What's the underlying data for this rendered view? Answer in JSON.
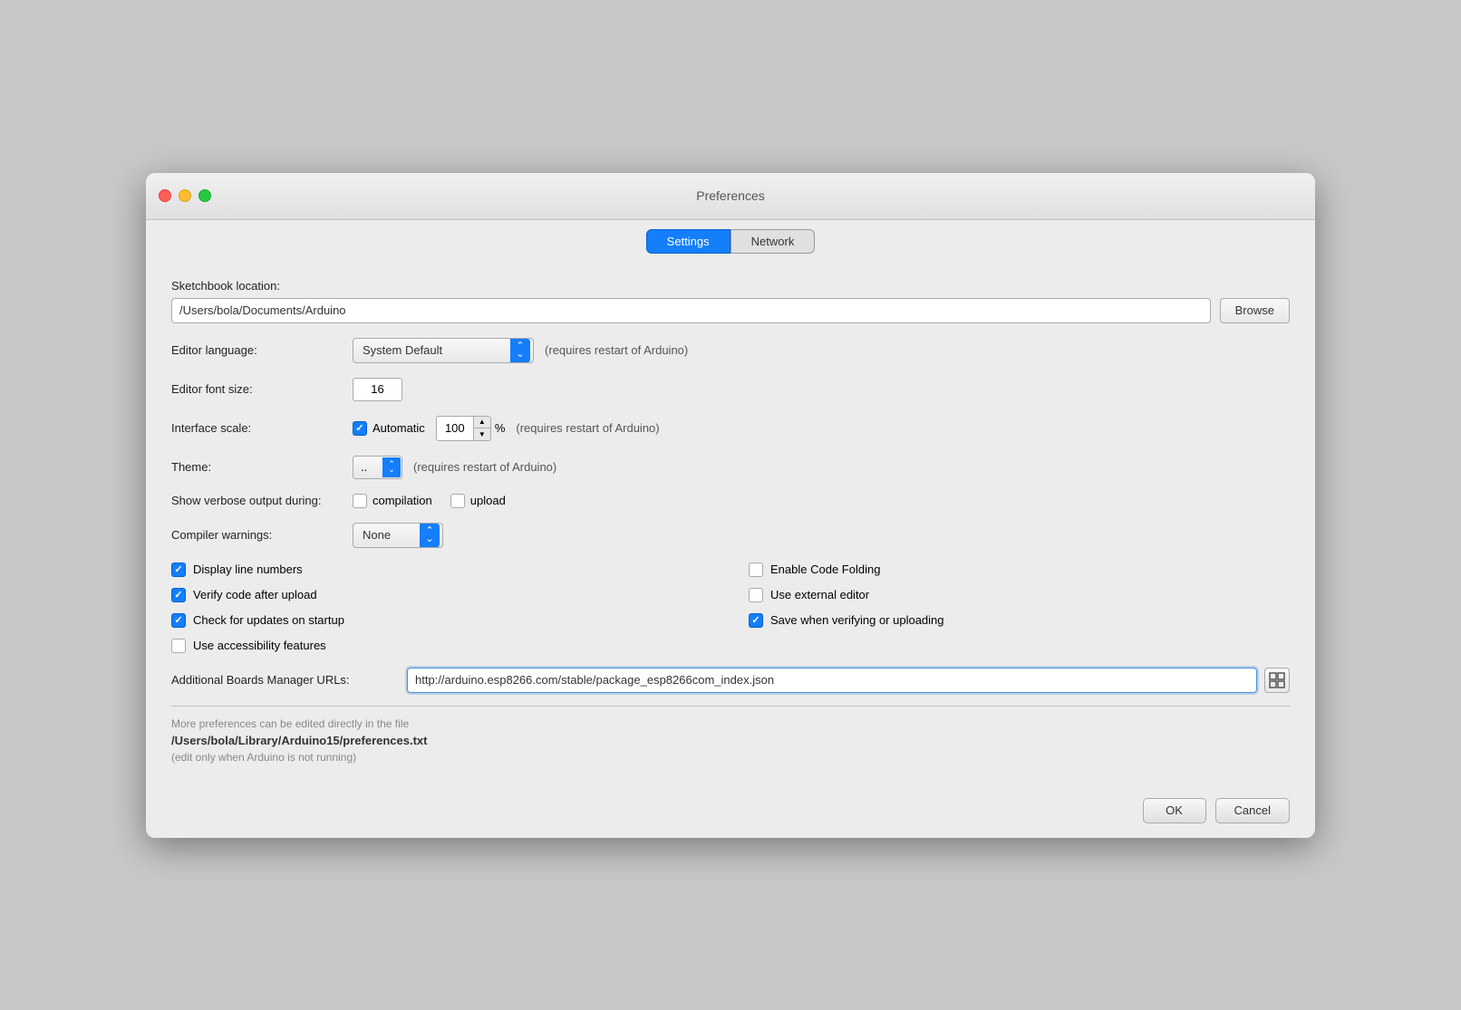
{
  "window": {
    "title": "Preferences"
  },
  "tabs": [
    {
      "id": "settings",
      "label": "Settings",
      "active": true
    },
    {
      "id": "network",
      "label": "Network",
      "active": false
    }
  ],
  "sketchbook": {
    "label": "Sketchbook location:",
    "value": "/Users/bola/Documents/Arduino",
    "browse_label": "Browse"
  },
  "editor_language": {
    "label": "Editor language:",
    "value": "System Default",
    "note": "(requires restart of Arduino)"
  },
  "editor_font_size": {
    "label": "Editor font size:",
    "value": "16"
  },
  "interface_scale": {
    "label": "Interface scale:",
    "auto_label": "Automatic",
    "auto_checked": true,
    "percent_value": "100",
    "percent_symbol": "%",
    "note": "(requires restart of Arduino)"
  },
  "theme": {
    "label": "Theme:",
    "value": "..",
    "note": "(requires restart of Arduino)"
  },
  "verbose_output": {
    "label": "Show verbose output during:",
    "compilation_label": "compilation",
    "upload_label": "upload",
    "compilation_checked": false,
    "upload_checked": false
  },
  "compiler_warnings": {
    "label": "Compiler warnings:",
    "value": "None"
  },
  "checkboxes": [
    {
      "id": "display-line-numbers",
      "label": "Display line numbers",
      "checked": true
    },
    {
      "id": "enable-code-folding",
      "label": "Enable Code Folding",
      "checked": false
    },
    {
      "id": "verify-code-after-upload",
      "label": "Verify code after upload",
      "checked": true
    },
    {
      "id": "use-external-editor",
      "label": "Use external editor",
      "checked": false
    },
    {
      "id": "check-for-updates",
      "label": "Check for updates on startup",
      "checked": true
    },
    {
      "id": "save-when-verifying",
      "label": "Save when verifying or uploading",
      "checked": true
    },
    {
      "id": "use-accessibility-features",
      "label": "Use accessibility features",
      "checked": false
    }
  ],
  "additional_boards": {
    "label": "Additional Boards Manager URLs:",
    "value": "http://arduino.esp8266.com/stable/package_esp8266com_index.json",
    "icon_label": "⊟"
  },
  "info": {
    "text": "More preferences can be edited directly in the file",
    "path": "/Users/bola/Library/Arduino15/preferences.txt",
    "note": "(edit only when Arduino is not running)"
  },
  "footer": {
    "ok_label": "OK",
    "cancel_label": "Cancel"
  }
}
